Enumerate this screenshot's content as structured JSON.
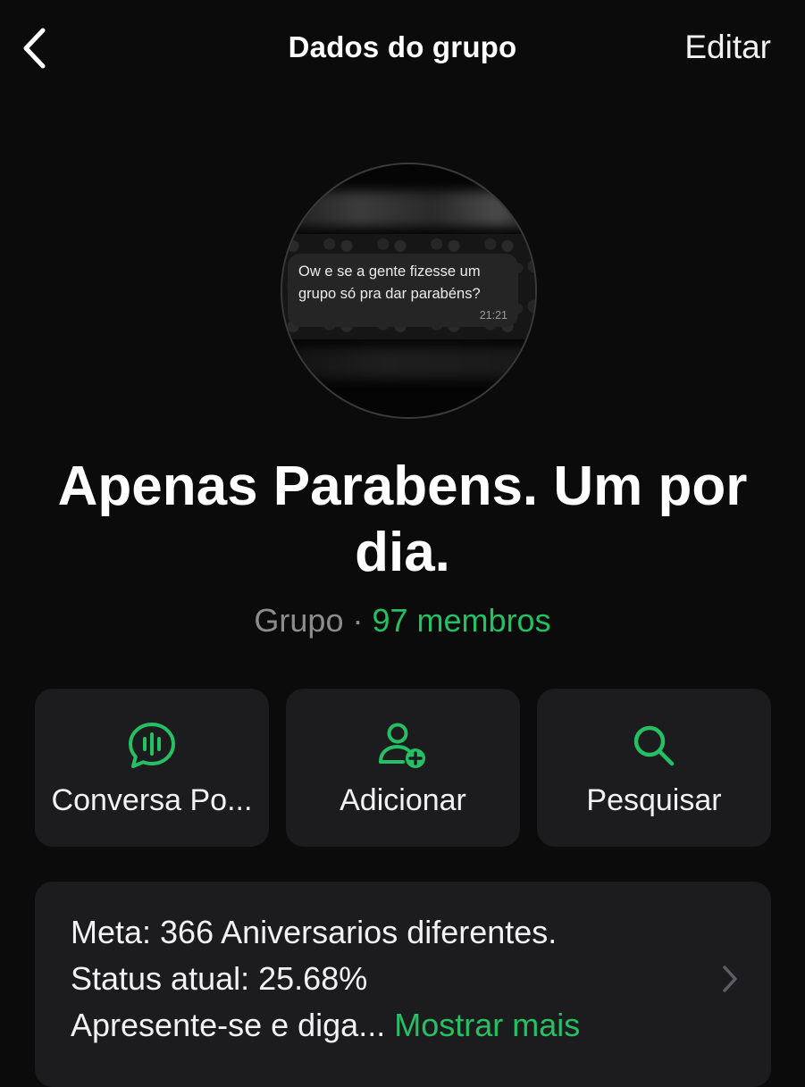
{
  "header": {
    "title": "Dados do grupo",
    "edit_label": "Editar",
    "back_icon": "chevron-left-icon"
  },
  "avatar": {
    "message_text": "Ow e se a gente fizesse um\ngrupo só pra dar parabéns?",
    "message_time": "21:21"
  },
  "group": {
    "name": "Apenas Parabens. Um por dia.",
    "type": "Grupo",
    "separator": "·",
    "members": "97 membros"
  },
  "actions": [
    {
      "label": "Conversa Po...",
      "icon": "voice-chat-icon"
    },
    {
      "label": "Adicionar",
      "icon": "add-person-icon"
    },
    {
      "label": "Pesquisar",
      "icon": "search-icon"
    }
  ],
  "description": {
    "line1": "Meta: 366 Aniversarios diferentes.",
    "line2": "Status atual: 25.68%",
    "line3": "Apresente-se e diga...",
    "more_label": "Mostrar mais"
  },
  "colors": {
    "background": "#0b0b0b",
    "card": "#1c1c1e",
    "accent": "#25c063",
    "muted": "#8c8c8c"
  }
}
